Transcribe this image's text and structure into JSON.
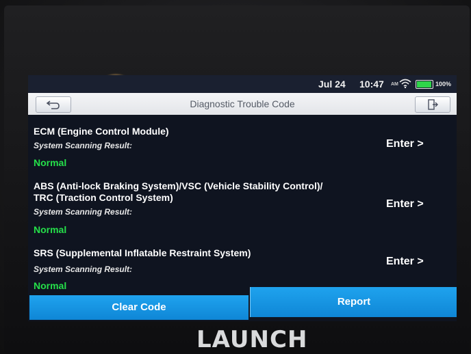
{
  "status_bar": {
    "date": "Jul 24",
    "time": "10:47",
    "network": "AM",
    "battery_percent": "100%",
    "battery_color": "#2fd64a"
  },
  "header": {
    "title": "Diagnostic Trouble Code",
    "back_icon": "back-arrow-icon",
    "exit_icon": "exit-door-icon"
  },
  "systems": [
    {
      "name": "ECM (Engine Control Module)",
      "result_label": "System Scanning Result:",
      "status": "Normal",
      "enter_label": "Enter >"
    },
    {
      "name_line1": "ABS (Anti-lock Braking System)/VSC (Vehicle Stability Control)/",
      "name_line2": "TRC (Traction Control System)",
      "result_label": "System Scanning Result:",
      "status": "Normal",
      "enter_label": "Enter >"
    },
    {
      "name": "SRS (Supplemental Inflatable Restraint System)",
      "result_label": "System Scanning Result:",
      "status": "Normal",
      "enter_label": "Enter >"
    }
  ],
  "footer": {
    "clear_label": "Clear Code",
    "report_label": "Report"
  },
  "device": {
    "brand": "LAUNCH"
  },
  "colors": {
    "accent_blue": "#1fa3ee",
    "status_normal": "#25e04a"
  }
}
